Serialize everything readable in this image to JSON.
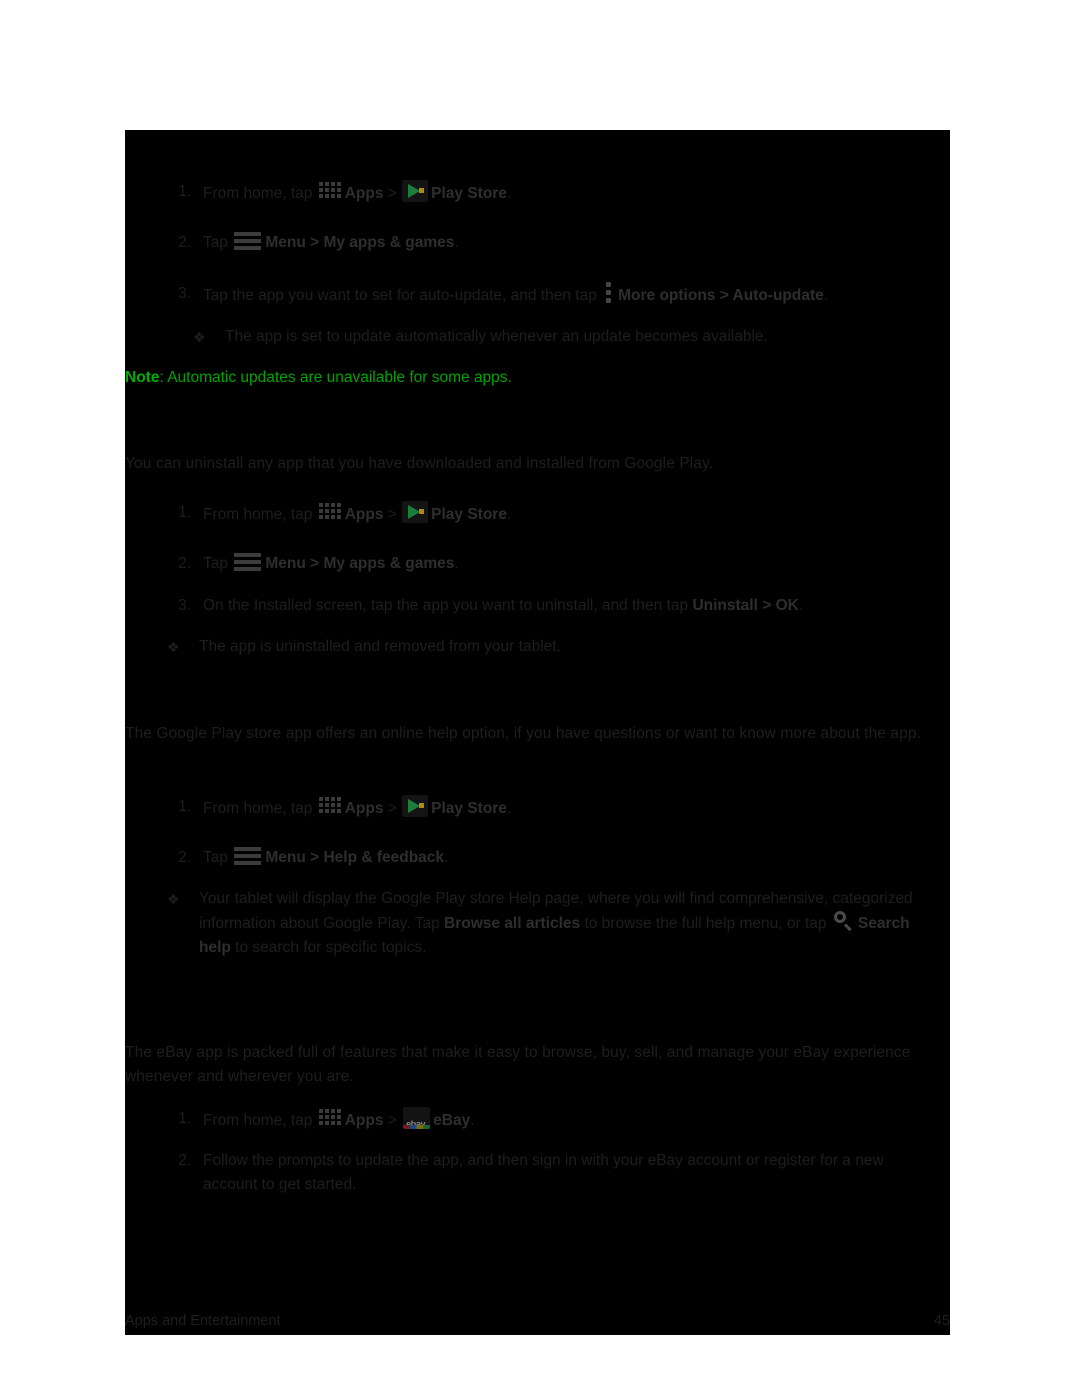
{
  "document": {
    "footer_section": "Apps and Entertainment",
    "page_number": "45"
  },
  "icons": {
    "apps": "apps-grid-icon",
    "play_store": "play-store-icon",
    "menu": "menu-hamburger-icon",
    "more_options": "more-options-icon",
    "search": "search-icon",
    "ebay": "ebay-icon"
  },
  "sections": [
    {
      "id": "auto-update",
      "steps": [
        {
          "num": "1.",
          "pre": "From home, tap ",
          "b1": "Apps",
          "mid": " > ",
          "b2": "Play Store",
          "post": "."
        },
        {
          "num": "2.",
          "pre": "Tap ",
          "b1": "Menu > My apps & games",
          "post": "."
        },
        {
          "num": "3.",
          "pre": "Tap the app you want to set for auto-update, and then tap ",
          "b1": "More options > Auto-update",
          "post": "."
        }
      ],
      "bullets": [
        "The app is set to update automatically whenever an update becomes available."
      ],
      "note": {
        "label": "Note",
        "text": ": Automatic updates are unavailable for some apps."
      }
    },
    {
      "id": "uninstall",
      "intro": "You can uninstall any app that you have downloaded and installed from Google Play.",
      "steps": [
        {
          "num": "1.",
          "pre": "From home, tap ",
          "b1": "Apps",
          "mid": " > ",
          "b2": "Play Store",
          "post": "."
        },
        {
          "num": "2.",
          "pre": "Tap ",
          "b1": "Menu > My apps & games",
          "post": "."
        },
        {
          "num": "3.",
          "pre": "On the Installed screen, tap the app you want to uninstall, and then tap ",
          "b1": "Uninstall > OK",
          "post": "."
        }
      ],
      "bullets": [
        "The app is uninstalled and removed from your tablet."
      ]
    },
    {
      "id": "get-help",
      "intro": "The Google Play store app offers an online help option, if you have questions or want to know more about the app.",
      "steps": [
        {
          "num": "1.",
          "pre": "From home, tap ",
          "b1": "Apps",
          "mid": " > ",
          "b2": "Play Store",
          "post": "."
        },
        {
          "num": "2.",
          "pre": "Tap ",
          "b1": "Menu > Help & feedback",
          "post": "."
        }
      ],
      "help_bullet": {
        "p1": "Your tablet will display the Google Play store Help page, where you will find comprehensive, categorized information about Google Play. Tap ",
        "b1": "Browse all articles",
        "p2": " to browse the full help menu, or tap ",
        "b2": "Search help",
        "p3": " to search for specific topics."
      }
    },
    {
      "id": "ebay",
      "intro": "The eBay app is packed full of features that make it easy to browse, buy, sell, and manage your eBay experience whenever and wherever you are.",
      "steps": [
        {
          "num": "1.",
          "pre": "From home, tap ",
          "b1": "Apps",
          "mid": " > ",
          "b2": "eBay",
          "post": "."
        },
        {
          "num": "2.",
          "pre": "Follow the prompts to update the app, and then sign in with your eBay account or register for a new account to get started.",
          "b1": "",
          "post": ""
        }
      ]
    }
  ]
}
